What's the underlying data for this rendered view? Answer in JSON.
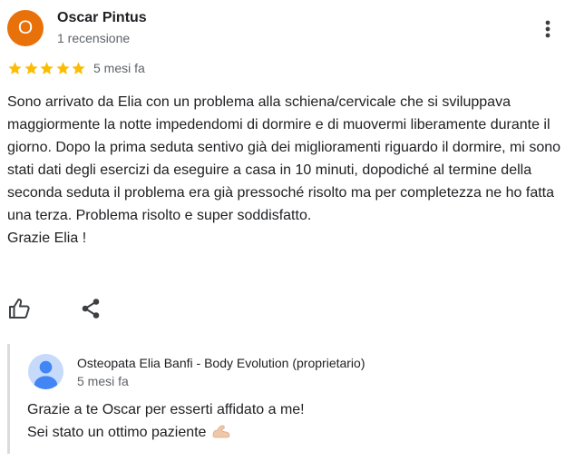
{
  "review": {
    "author": {
      "initial": "O",
      "name": "Oscar Pintus",
      "review_count": "1 recensione",
      "avatar_color": "#e8710a"
    },
    "rating": 5,
    "date": "5 mesi fa",
    "text_lines": [
      "Sono arrivato da Elia con un problema alla schiena/cervicale che si sviluppava maggiormente la notte impedendomi di dormire e di muovermi liberamente durante il giorno. Dopo la prima seduta sentivo già dei miglioramenti riguardo il dormire, mi sono stati dati degli esercizi da eseguire a casa in 10 minuti, dopodiché al termine della seconda seduta il problema era già pressoché risolto ma per completezza ne ho fatta una terza. Problema risolto e super soddisfatto.",
      "Grazie Elia !"
    ],
    "actions": {
      "like_icon": "thumb-up-icon",
      "share_icon": "share-icon"
    },
    "colors": {
      "star": "#fbbc04",
      "icon": "#3c4043",
      "secondary_text": "#5f6368"
    }
  },
  "owner_reply": {
    "name": "Osteopata Elia Banfi - Body Evolution (proprietario)",
    "date": "5 mesi fa",
    "lines": [
      "Grazie a te Oscar per esserti affidato a me!",
      "Sei stato un ottimo paziente"
    ],
    "emoji_icon": "flexed-biceps-icon",
    "avatar_icon": "default-person-avatar-icon"
  }
}
